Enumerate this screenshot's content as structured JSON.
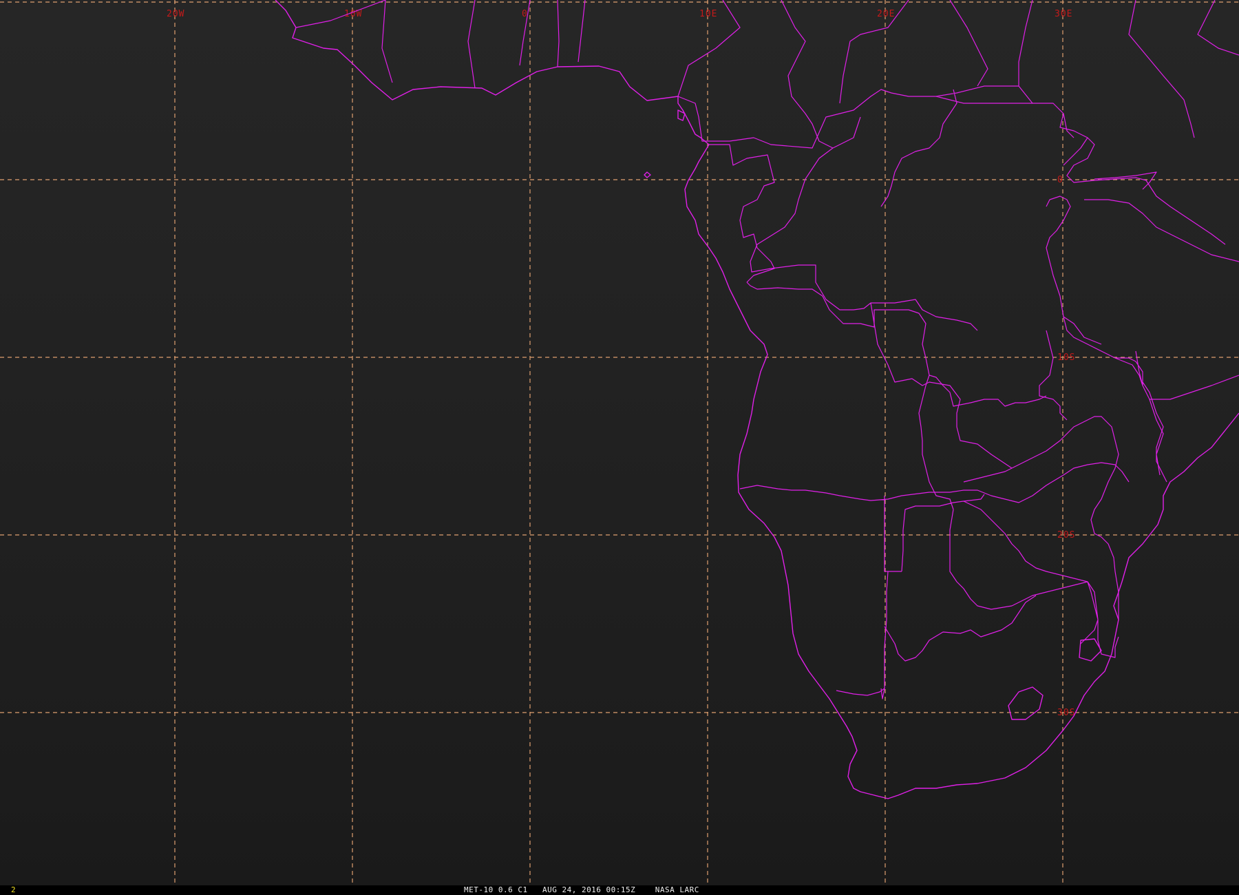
{
  "map": {
    "meridians": [
      {
        "lon": -20,
        "label": "20W"
      },
      {
        "lon": -10,
        "label": "10W"
      },
      {
        "lon": 0,
        "label": "0"
      },
      {
        "lon": 10,
        "label": "10E"
      },
      {
        "lon": 20,
        "label": "20E"
      },
      {
        "lon": 30,
        "label": "30E"
      }
    ],
    "parallels": [
      {
        "lat": 0,
        "label": "0"
      },
      {
        "lat": -10,
        "label": "10S"
      },
      {
        "lat": -20,
        "label": "20S"
      },
      {
        "lat": -30,
        "label": "30S"
      }
    ],
    "colors": {
      "coastline": "#e020e8",
      "gridline": "#e0a070",
      "grid_label": "#c41a1a",
      "background": "#222222"
    }
  },
  "status_bar": {
    "frame_number": "2",
    "caption": "MET-10 0.6 C1   AUG 24, 2016 00:15Z    NASA LARC"
  }
}
